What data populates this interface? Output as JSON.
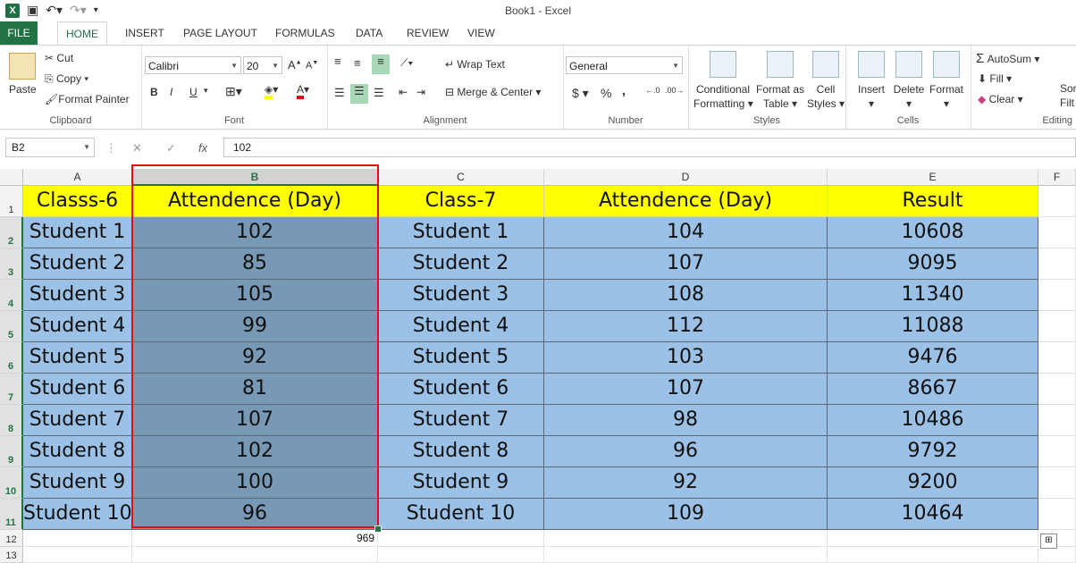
{
  "window": {
    "title": "Book1 - Excel"
  },
  "tabs": [
    "FILE",
    "HOME",
    "INSERT",
    "PAGE LAYOUT",
    "FORMULAS",
    "DATA",
    "REVIEW",
    "VIEW"
  ],
  "ribbon": {
    "clipboard": {
      "paste": "Paste",
      "cut": "Cut",
      "copy": "Copy",
      "format_painter": "Format Painter",
      "label": "Clipboard"
    },
    "font": {
      "name": "Calibri",
      "size": "20",
      "bold": "B",
      "italic": "I",
      "underline": "U",
      "label": "Font"
    },
    "alignment": {
      "wrap": "Wrap Text",
      "merge": "Merge & Center",
      "label": "Alignment"
    },
    "number": {
      "format": "General",
      "currency": "$",
      "percent": "%",
      "comma": ",",
      "label": "Number"
    },
    "styles": {
      "cond1": "Conditional",
      "cond2": "Formatting",
      "fat1": "Format as",
      "fat2": "Table",
      "cs1": "Cell",
      "cs2": "Styles",
      "label": "Styles"
    },
    "cells": {
      "insert": "Insert",
      "delete": "Delete",
      "format": "Format",
      "label": "Cells"
    },
    "editing": {
      "autosum": "AutoSum",
      "fill": "Fill",
      "clear": "Clear",
      "sort": "Sor",
      "find": "Filt",
      "label": "Editing"
    }
  },
  "formula_bar": {
    "name_box": "B2",
    "value": "102",
    "fx": "fx"
  },
  "columns": [
    "A",
    "B",
    "C",
    "D",
    "E",
    "F"
  ],
  "rows": [
    "1",
    "2",
    "3",
    "4",
    "5",
    "6",
    "7",
    "8",
    "9",
    "10",
    "11",
    "12",
    "13"
  ],
  "table": {
    "headers": [
      "Classs-6",
      "Attendence (Day)",
      "Class-7",
      "Attendence (Day)",
      "Result"
    ],
    "data": [
      [
        "Student 1",
        "102",
        "Student 1",
        "104",
        "10608"
      ],
      [
        "Student 2",
        "85",
        "Student 2",
        "107",
        "9095"
      ],
      [
        "Student 3",
        "105",
        "Student 3",
        "108",
        "11340"
      ],
      [
        "Student 4",
        "99",
        "Student 4",
        "112",
        "11088"
      ],
      [
        "Student 5",
        "92",
        "Student 5",
        "103",
        "9476"
      ],
      [
        "Student 6",
        "81",
        "Student 6",
        "107",
        "8667"
      ],
      [
        "Student 7",
        "107",
        "Student 7",
        "98",
        "10486"
      ],
      [
        "Student 8",
        "102",
        "Student 8",
        "96",
        "9792"
      ],
      [
        "Student 9",
        "100",
        "Student 9",
        "92",
        "9200"
      ],
      [
        "Student 10",
        "96",
        "Student 10",
        "109",
        "10464"
      ]
    ],
    "sum_b12": "969"
  },
  "colors": {
    "header_fill": "#ffff00",
    "body_fill": "#9bc2e6",
    "selected_fill": "#7799b5",
    "selection_border": "#e01010",
    "excel_green": "#217346"
  }
}
